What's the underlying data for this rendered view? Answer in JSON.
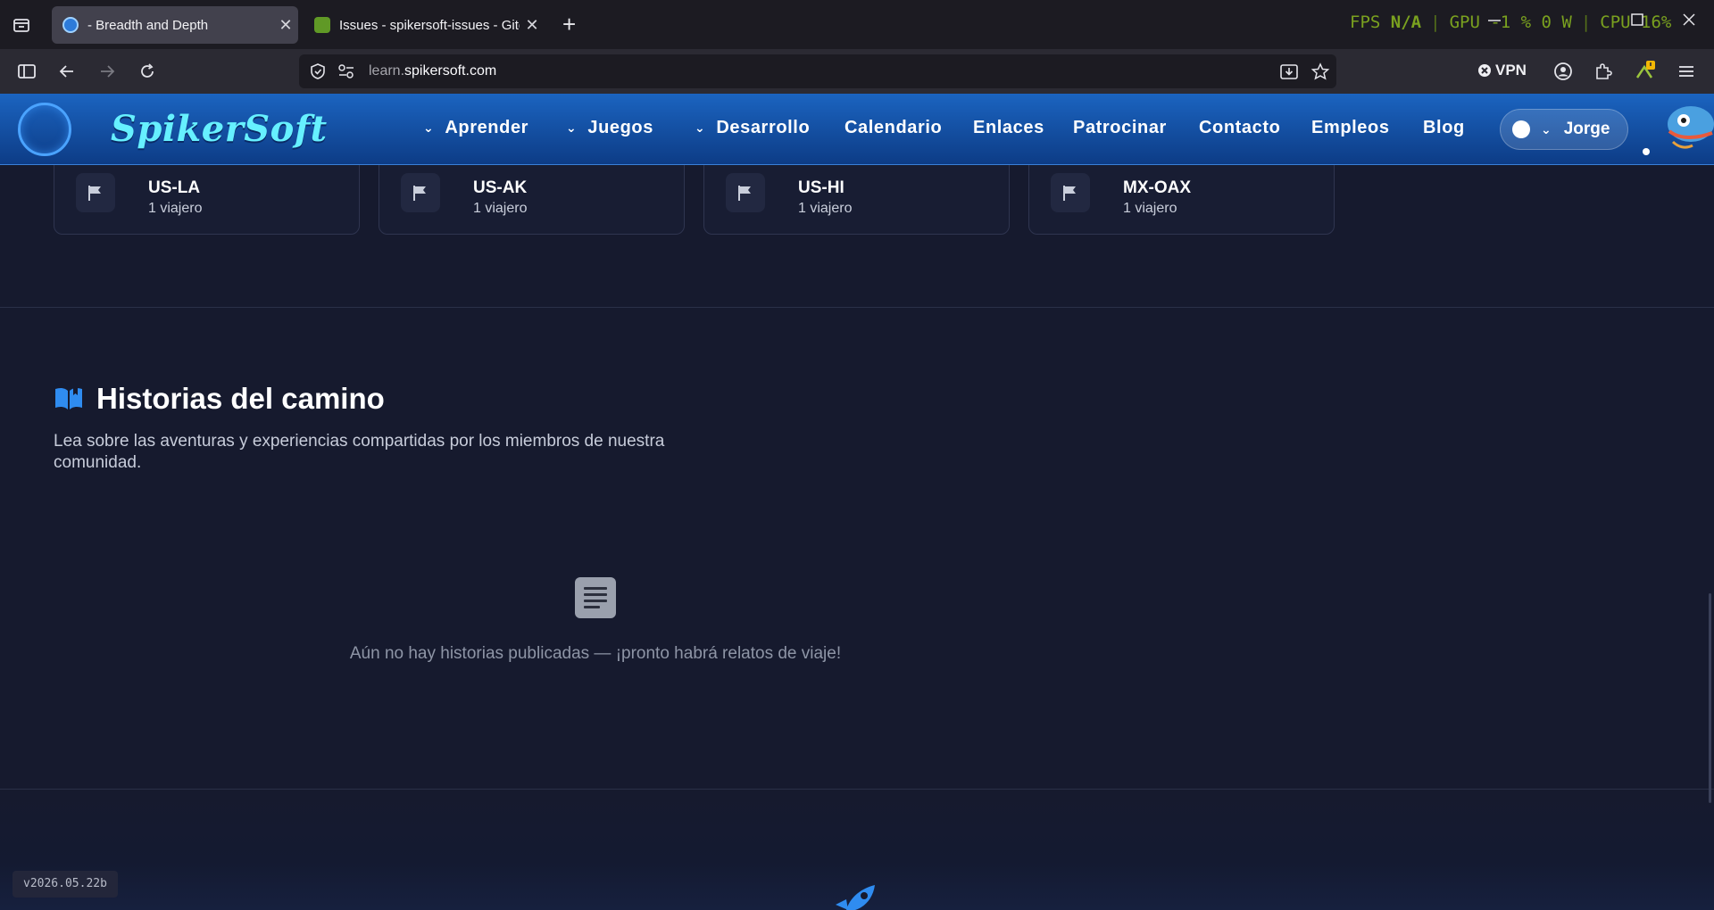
{
  "browser": {
    "tabs": [
      {
        "title": "- Breadth and Depth",
        "active": true
      },
      {
        "title": "Issues - spikersoft-issues - Gitea",
        "active": false
      }
    ],
    "new_tab": "+",
    "close_glyph": "✕",
    "perf": {
      "fps_label": "FPS",
      "fps_value": "N/A",
      "gpu": "GPU -1 % 0 W",
      "cpu": "CPU 16%"
    },
    "url": {
      "prefix": "learn.",
      "domain": "spikersoft.com"
    },
    "vpn_label": "VPN"
  },
  "site": {
    "brand": "SpikerSoft",
    "menu": {
      "aprender": "Aprender",
      "juegos": "Juegos",
      "desarrollo": "Desarrollo",
      "calendario": "Calendario",
      "enlaces": "Enlaces",
      "patrocinar": "Patrocinar",
      "contacto": "Contacto",
      "empleos": "Empleos",
      "blog": "Blog"
    },
    "user": "Jorge"
  },
  "regions": [
    {
      "code": "US-LA",
      "travelers": "1 viajero"
    },
    {
      "code": "US-AK",
      "travelers": "1 viajero"
    },
    {
      "code": "US-HI",
      "travelers": "1 viajero"
    },
    {
      "code": "MX-OAX",
      "travelers": "1 viajero"
    }
  ],
  "stories": {
    "title": "Historias del camino",
    "description": "Lea sobre las aventuras y experiencias compartidas por los miembros de nuestra comunidad.",
    "empty_text": "Aún no hay historias publicadas — ¡pronto habrá relatos de viaje!"
  },
  "version": "v2026.05.22b",
  "icons": {
    "tab_list": "tab-list-icon",
    "back": "arrow-left-icon",
    "forward": "arrow-right-icon",
    "reload": "reload-icon",
    "shield": "shield-icon",
    "download": "download-icon",
    "bookmark": "star-icon",
    "account": "account-icon",
    "extensions": "puzzle-icon",
    "menu": "hamburger-icon",
    "flag": "flag-icon",
    "book": "book-open-icon",
    "document": "document-icon",
    "rocket": "rocket-icon"
  },
  "colors": {
    "accent": "#1b64c0",
    "brand_text": "#66f0ff",
    "page_bg": "#161a2e",
    "fps_text": "#7aa11f"
  }
}
